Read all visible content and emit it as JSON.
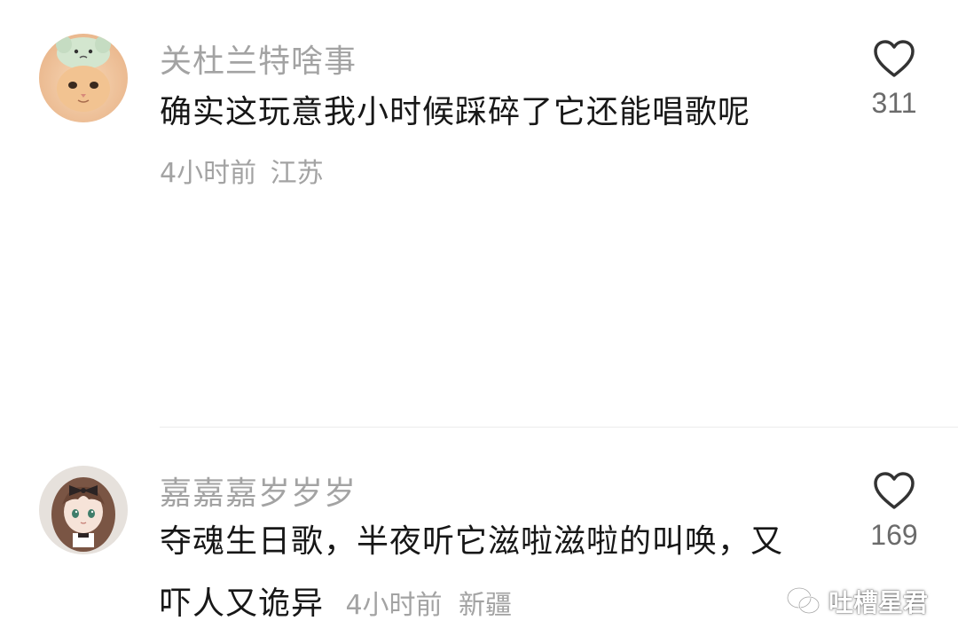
{
  "comments": [
    {
      "username": "关杜兰特啥事",
      "text": "确实这玩意我小时候踩碎了它还能唱歌呢",
      "time": "4小时前",
      "location": "江苏",
      "likes": "311",
      "avatar_icon": "cat-with-plush-hat-avatar"
    },
    {
      "username": "嘉嘉嘉岁岁岁",
      "text_line1": "夺魂生日歌，半夜听它滋啦滋啦的叫唤，又",
      "text_line2": "吓人又诡异",
      "time": "4小时前",
      "location": "新疆",
      "likes": "169",
      "avatar_icon": "anime-girl-avatar"
    }
  ],
  "watermark": {
    "text": "吐槽星君",
    "icon": "wechat-icon"
  },
  "colors": {
    "username": "#a3a3a3",
    "text": "#171717",
    "meta": "#a3a3a3",
    "like_count": "#6b6b6b"
  }
}
